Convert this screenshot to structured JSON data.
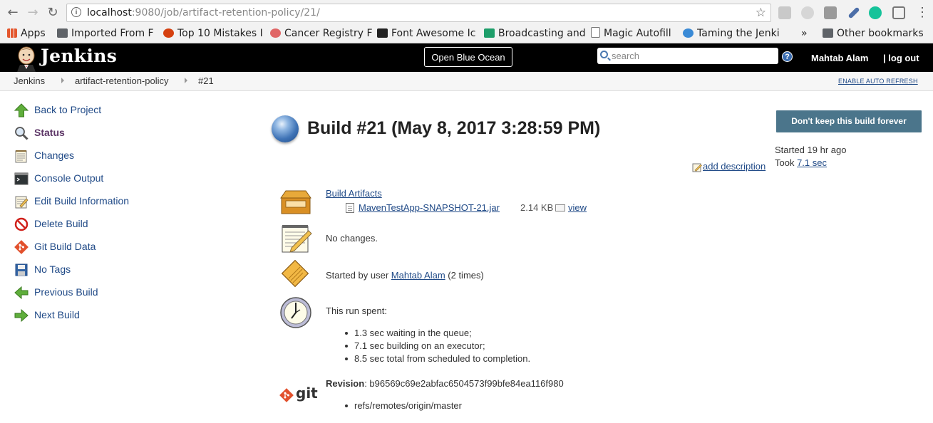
{
  "browser": {
    "url_host": "localhost",
    "url_rest": ":9080/job/artifact-retention-policy/21/",
    "bookmarks": [
      {
        "label": "Apps"
      },
      {
        "label": "Imported From F"
      },
      {
        "label": "Top 10 Mistakes I"
      },
      {
        "label": "Cancer Registry F"
      },
      {
        "label": "Font Awesome Ic"
      },
      {
        "label": "Broadcasting and"
      },
      {
        "label": "Magic Autofill"
      },
      {
        "label": "Taming the Jenki"
      }
    ],
    "overflow": "»",
    "other_bookmarks": "Other bookmarks"
  },
  "header": {
    "title": "Jenkins",
    "blue_ocean": "Open Blue Ocean",
    "search_placeholder": "search",
    "help": "?",
    "user": "Mahtab Alam",
    "logout_sep": "|",
    "logout": "log out"
  },
  "breadcrumb": {
    "items": [
      "Jenkins",
      "artifact-retention-policy",
      "#21"
    ],
    "auto_refresh": "ENABLE AUTO REFRESH"
  },
  "sidebar": {
    "items": [
      {
        "label": "Back to Project",
        "icon": "up-arrow-icon"
      },
      {
        "label": "Status",
        "icon": "magnifier-icon",
        "active": true
      },
      {
        "label": "Changes",
        "icon": "notepad-icon"
      },
      {
        "label": "Console Output",
        "icon": "terminal-icon"
      },
      {
        "label": "Edit Build Information",
        "icon": "notepad-edit-icon"
      },
      {
        "label": "Delete Build",
        "icon": "no-entry-icon"
      },
      {
        "label": "Git Build Data",
        "icon": "git-icon"
      },
      {
        "label": "No Tags",
        "icon": "save-icon"
      },
      {
        "label": "Previous Build",
        "icon": "left-arrow-icon"
      },
      {
        "label": "Next Build",
        "icon": "right-arrow-icon"
      }
    ]
  },
  "main": {
    "build_title": "Build #21 (May 8, 2017 3:28:59 PM)",
    "keep_button": "Don't keep this build forever",
    "started_ago": "Started 19 hr ago",
    "took_label": "Took ",
    "took_value": "7.1 sec",
    "add_description": "add description",
    "artifacts_label": "Build Artifacts",
    "artifact_name": "MavenTestApp-SNAPSHOT-21.jar",
    "artifact_size": "2.14 KB",
    "view": "view",
    "no_changes": "No changes.",
    "started_by_prefix": "Started by user ",
    "started_by_user": "Mahtab Alam",
    "started_by_suffix": " (2 times)",
    "run_spent": "This run spent:",
    "timings": [
      "1.3 sec waiting in the queue;",
      "7.1 sec building on an executor;",
      "8.5 sec total from scheduled to completion."
    ],
    "revision_label": "Revision",
    "revision_value": ": b96569c69e2abfac6504573f99bfe84ea116f980",
    "git_text": "git",
    "branch": "refs/remotes/origin/master"
  }
}
